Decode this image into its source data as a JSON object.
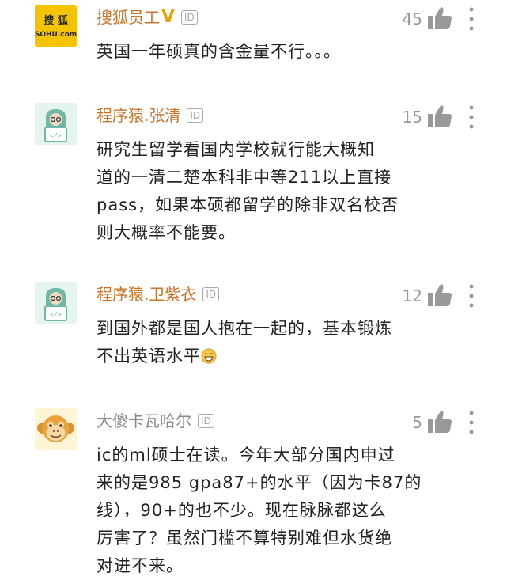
{
  "comments": [
    {
      "username": "搜狐员工",
      "verified_mark": "V",
      "id_badge": "ID",
      "likes": "45",
      "avatar": {
        "kind": "brand-logo",
        "text_top": "搜 狐",
        "text_bottom": "SOHU.com",
        "bg": "#f5c400"
      },
      "lines": [
        "英国一年硕真的含金量不行。。。"
      ]
    },
    {
      "username": "程序猿.张清",
      "id_badge": "ID",
      "likes": "15",
      "avatar": {
        "kind": "coder-icon",
        "bg": "#e6f4ef",
        "code_text": "</>"
      },
      "lines": [
        "研究生留学看国内学校就行能大概知",
        "道的一清二楚本科非中等211以上直接",
        "pass，如果本硕都留学的除非双名校否",
        "则大概率不能要。"
      ]
    },
    {
      "username": "程序猿.卫紫衣",
      "id_badge": "ID",
      "likes": "12",
      "avatar": {
        "kind": "coder-icon",
        "bg": "#e6f4ef",
        "code_text": "</>"
      },
      "lines": [
        "到国外都是国人抱在一起的，基本锻炼",
        "不出英语水平"
      ],
      "trailing_icon": "grinning-sweat-emoji"
    },
    {
      "username": "大傻卡瓦哈尔",
      "id_badge": "ID",
      "likes": "5",
      "avatar": {
        "kind": "monkey-icon",
        "bg": "#fff4d6"
      },
      "lines": [
        "ic的ml硕士在读。今年大部分国内申过",
        "来的是985 gpa87+的水平（因为卡87的",
        "线），90+的也不少。现在脉脉都这么",
        "厉害了？虽然门槛不算特别难但水货绝",
        "对进不来。"
      ]
    }
  ],
  "colors": {
    "brand_name": "#c9732c",
    "grey_name": "#888888",
    "verified": "#e8a400",
    "muted": "#a8a8a8"
  },
  "icons": {
    "like": "thumbs-up-icon",
    "more": "vertical-dots-icon"
  }
}
